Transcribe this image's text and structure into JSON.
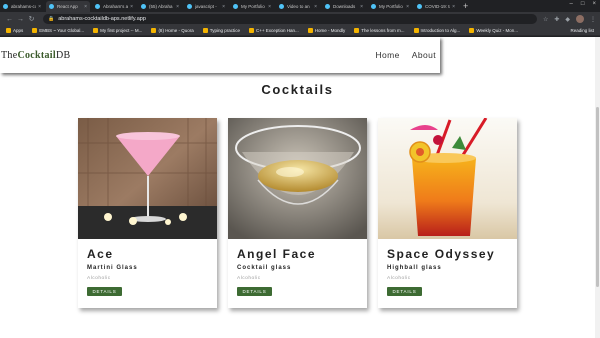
{
  "browser": {
    "tabs": [
      {
        "label": "abrahams-co"
      },
      {
        "label": "React App"
      },
      {
        "label": "Abraham's a"
      },
      {
        "label": "(55) Abraha"
      },
      {
        "label": "javascript -"
      },
      {
        "label": "My Portfolio"
      },
      {
        "label": "Video to an"
      },
      {
        "label": "Downloads"
      },
      {
        "label": "My Portfolio"
      },
      {
        "label": "COVID-19: tr"
      }
    ],
    "url": "abrahams-cocktaildb-aps.netlify.app",
    "bookmarks": [
      {
        "label": "Apps"
      },
      {
        "label": "EMBS ~ Your Global..."
      },
      {
        "label": "My first project -- M..."
      },
      {
        "label": "(8) Home - Quora"
      },
      {
        "label": "Typing practice"
      },
      {
        "label": "C++ Exception Han..."
      },
      {
        "label": "Home - Mondly"
      },
      {
        "label": "The lessons from m..."
      },
      {
        "label": "Introduction to Alg..."
      },
      {
        "label": "Weekly Quiz - Mon..."
      }
    ],
    "reading_list": "Reading list"
  },
  "page": {
    "logo": {
      "prefix": "The",
      "bold": "Cocktail",
      "suffix": "DB"
    },
    "nav": {
      "home": "Home",
      "about": "About"
    },
    "heading": "Cocktails",
    "cards": [
      {
        "name": "Ace",
        "glass": "Martini Glass",
        "info": "Alcoholic",
        "button": "DETAILS"
      },
      {
        "name": "Angel Face",
        "glass": "Cocktail glass",
        "info": "Alcoholic",
        "button": "DETAILS"
      },
      {
        "name": "Space Odyssey",
        "glass": "Highball glass",
        "info": "Alcoholic",
        "button": "DETAILS"
      }
    ]
  },
  "colors": {
    "accent": "#3d6b33",
    "logo_bold": "#3a5a2a"
  }
}
